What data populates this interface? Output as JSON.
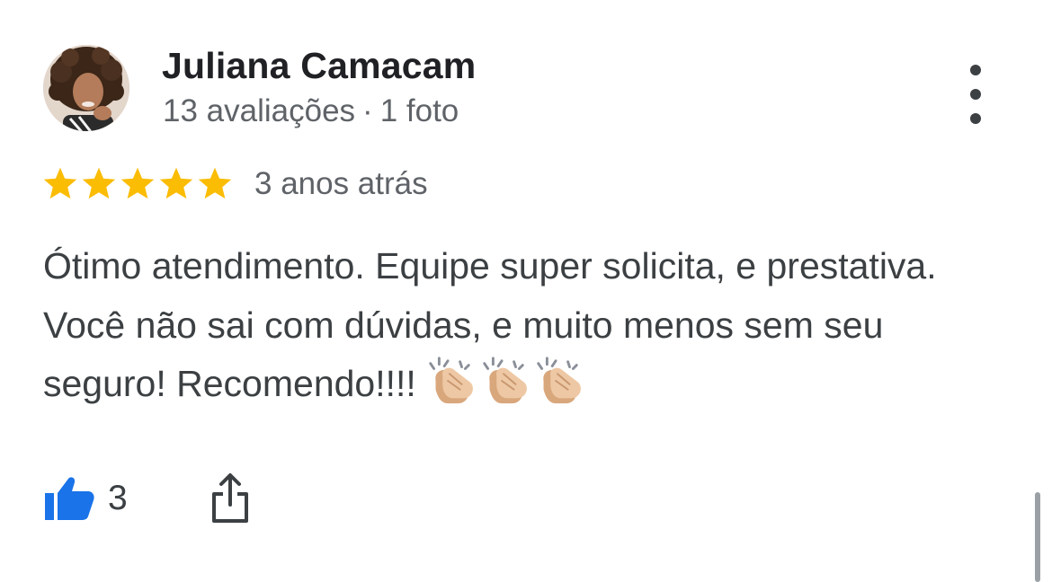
{
  "review": {
    "author": {
      "name": "Juliana Camacam",
      "reviews_count": "13 avaliações",
      "separator": "·",
      "photos_count": "1 foto"
    },
    "rating": 5,
    "star_color": "#fbbc04",
    "date": "3 anos atrás",
    "text": "Ótimo atendimento. Equipe super solicita, e prestativa. Você não sai com dúvidas, e muito menos sem seu seguro! Recomendo!!!!",
    "emojis": [
      "clapping-hands",
      "clapping-hands",
      "clapping-hands"
    ],
    "likes": "3",
    "like_color": "#1a73e8",
    "icons": {
      "more": "more-vert-icon",
      "like": "thumb-up-icon",
      "share": "share-icon"
    }
  }
}
